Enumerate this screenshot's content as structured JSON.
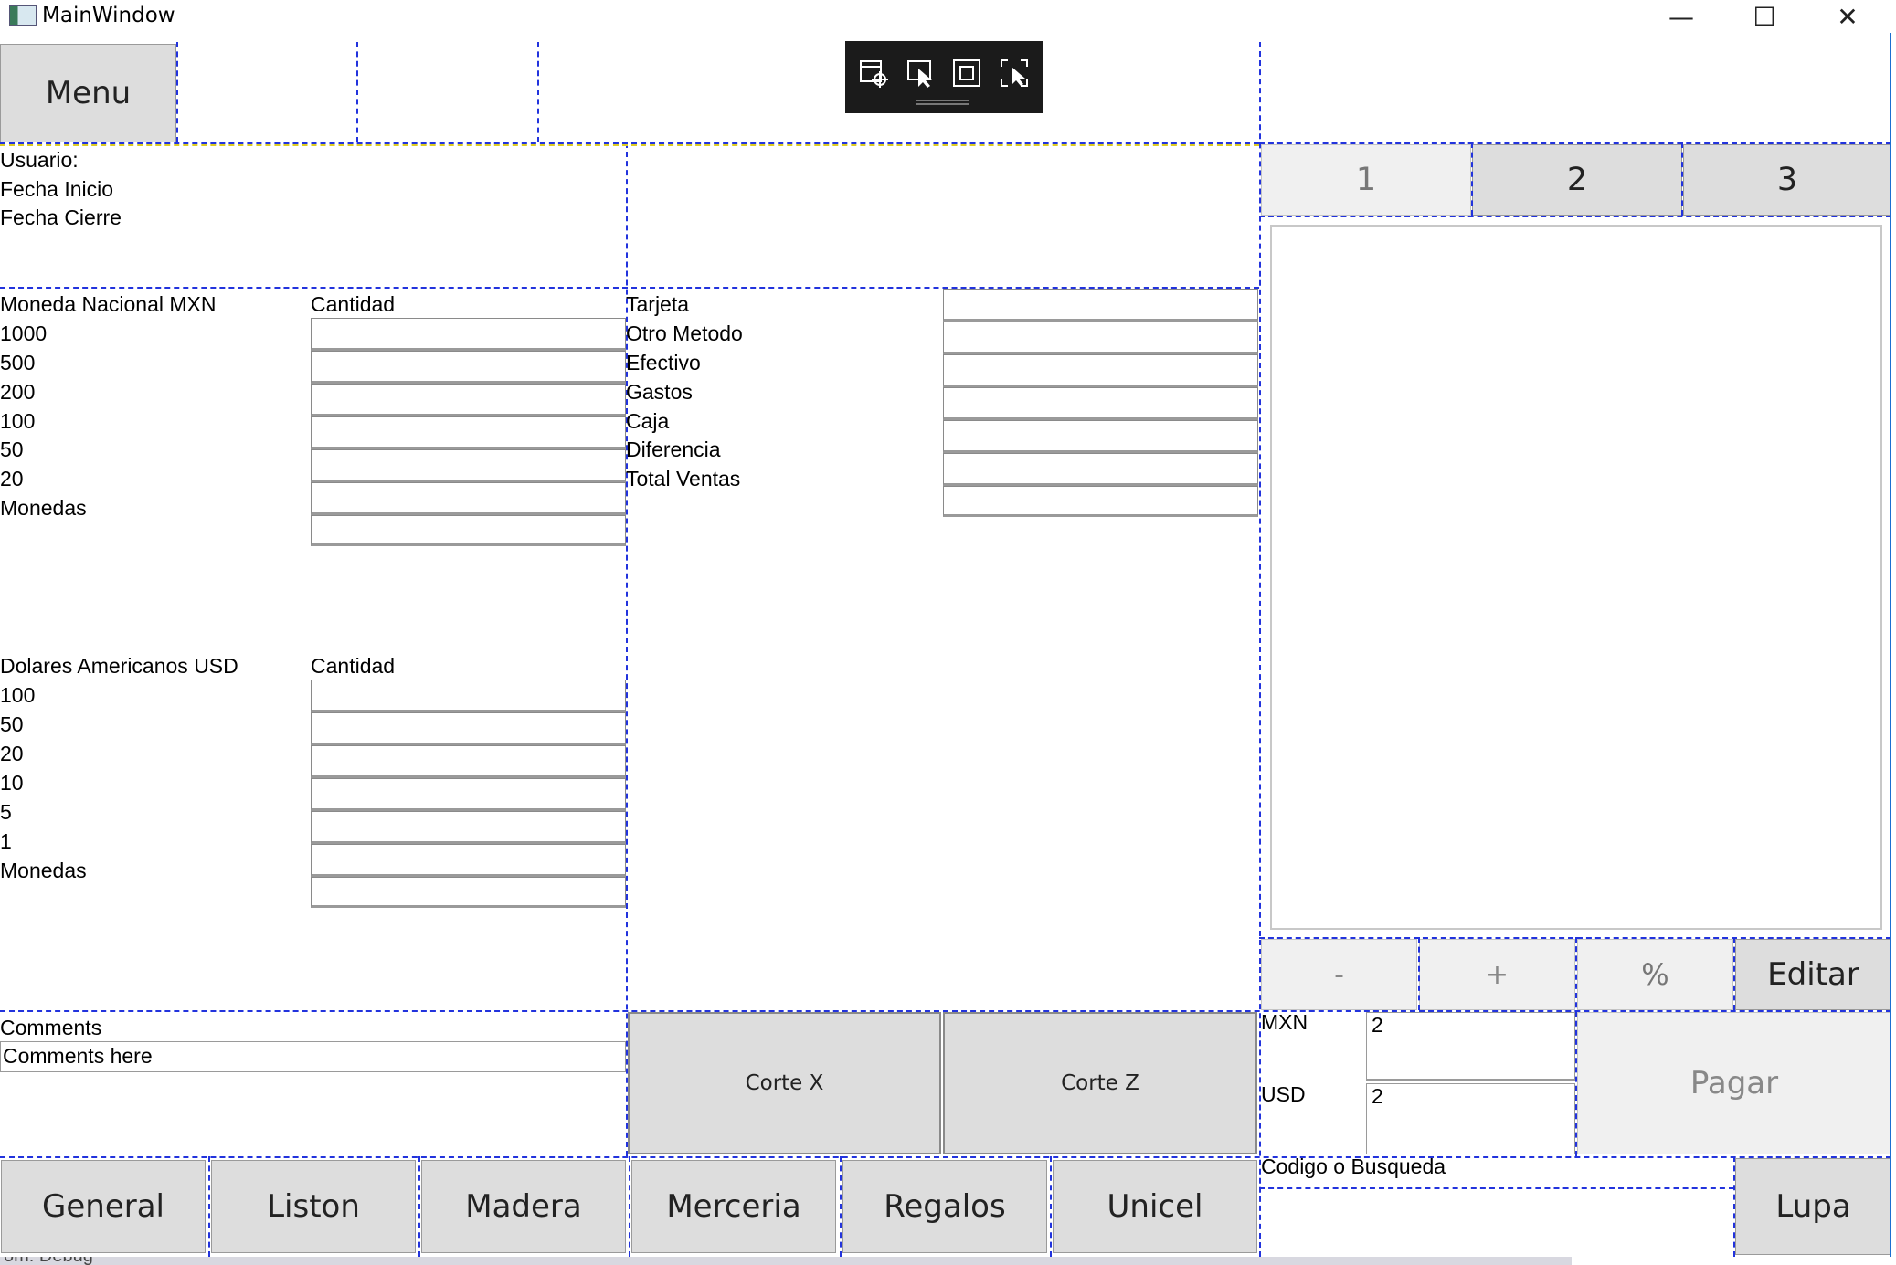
{
  "window": {
    "title": "MainWindow",
    "minimize_glyph": "—",
    "maximize_glyph": "☐",
    "close_glyph": "✕"
  },
  "toolbar": {
    "menu_label": "Menu"
  },
  "session": {
    "usuario_label": "Usuario:",
    "fecha_inicio_label": "Fecha Inicio",
    "fecha_cierre_label": "Fecha Cierre"
  },
  "mxn": {
    "header": "Moneda Nacional MXN",
    "quantity_header": "Cantidad",
    "denominations": [
      "1000",
      "500",
      "200",
      "100",
      "50",
      "20",
      "Monedas"
    ]
  },
  "usd": {
    "header": "Dolares Americanos USD",
    "quantity_header": "Cantidad",
    "denominations": [
      "100",
      "50",
      "20",
      "10",
      "5",
      "1",
      "Monedas"
    ]
  },
  "summary": {
    "rows": [
      "Tarjeta",
      "Otro Metodo",
      "Efectivo",
      "Gastos",
      "Caja",
      "Diferencia",
      "Total Ventas"
    ]
  },
  "comments": {
    "label": "Comments",
    "value": "Comments here"
  },
  "cut_buttons": {
    "corte_x": "Corte X",
    "corte_z": "Corte Z"
  },
  "tabs": [
    "1",
    "2",
    "3"
  ],
  "adjust_buttons": {
    "minus": "-",
    "plus": "+",
    "percent": "%",
    "edit": "Editar"
  },
  "payment": {
    "mxn_label": "MXN",
    "mxn_value": "2",
    "usd_label": "USD",
    "usd_value": "2",
    "pay_label": "Pagar"
  },
  "search": {
    "label": "Codigo o Busqueda",
    "button": "Lupa"
  },
  "categories": [
    "General",
    "Liston",
    "Madera",
    "Merceria",
    "Regalos",
    "Unicel"
  ],
  "status_strip": {
    "text": "om:  Debug"
  }
}
